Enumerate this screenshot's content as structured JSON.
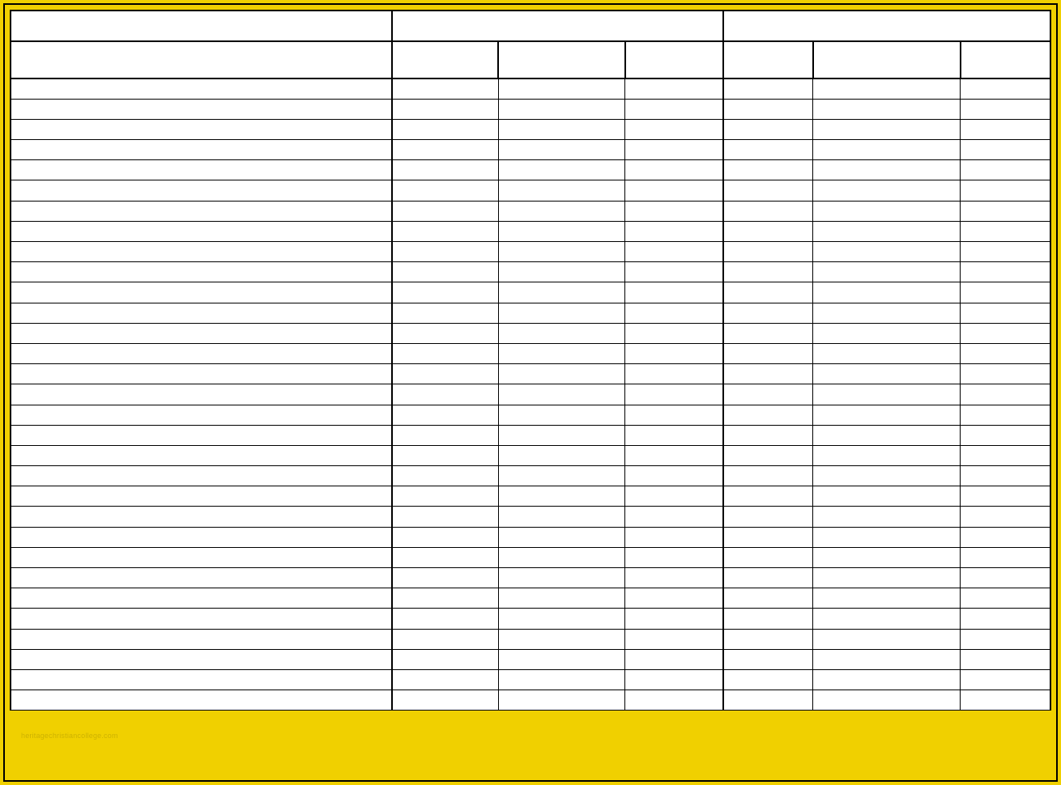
{
  "sheet": {
    "top_headers": {
      "left": "",
      "group1": "",
      "group2": ""
    },
    "sub_headers": {
      "left": "",
      "b": "",
      "c": "",
      "d": "",
      "e": "",
      "f": "",
      "g": ""
    },
    "rows": [
      {
        "a": "",
        "b": "",
        "c": "",
        "d": "",
        "e": "",
        "f": "",
        "g": ""
      },
      {
        "a": "",
        "b": "",
        "c": "",
        "d": "",
        "e": "",
        "f": "",
        "g": ""
      },
      {
        "a": "",
        "b": "",
        "c": "",
        "d": "",
        "e": "",
        "f": "",
        "g": ""
      },
      {
        "a": "",
        "b": "",
        "c": "",
        "d": "",
        "e": "",
        "f": "",
        "g": ""
      },
      {
        "a": "",
        "b": "",
        "c": "",
        "d": "",
        "e": "",
        "f": "",
        "g": ""
      },
      {
        "a": "",
        "b": "",
        "c": "",
        "d": "",
        "e": "",
        "f": "",
        "g": ""
      },
      {
        "a": "",
        "b": "",
        "c": "",
        "d": "",
        "e": "",
        "f": "",
        "g": ""
      },
      {
        "a": "",
        "b": "",
        "c": "",
        "d": "",
        "e": "",
        "f": "",
        "g": ""
      },
      {
        "a": "",
        "b": "",
        "c": "",
        "d": "",
        "e": "",
        "f": "",
        "g": ""
      },
      {
        "a": "",
        "b": "",
        "c": "",
        "d": "",
        "e": "",
        "f": "",
        "g": ""
      },
      {
        "a": "",
        "b": "",
        "c": "",
        "d": "",
        "e": "",
        "f": "",
        "g": ""
      },
      {
        "a": "",
        "b": "",
        "c": "",
        "d": "",
        "e": "",
        "f": "",
        "g": ""
      },
      {
        "a": "",
        "b": "",
        "c": "",
        "d": "",
        "e": "",
        "f": "",
        "g": ""
      },
      {
        "a": "",
        "b": "",
        "c": "",
        "d": "",
        "e": "",
        "f": "",
        "g": ""
      },
      {
        "a": "",
        "b": "",
        "c": "",
        "d": "",
        "e": "",
        "f": "",
        "g": ""
      },
      {
        "a": "",
        "b": "",
        "c": "",
        "d": "",
        "e": "",
        "f": "",
        "g": ""
      },
      {
        "a": "",
        "b": "",
        "c": "",
        "d": "",
        "e": "",
        "f": "",
        "g": ""
      },
      {
        "a": "",
        "b": "",
        "c": "",
        "d": "",
        "e": "",
        "f": "",
        "g": ""
      },
      {
        "a": "",
        "b": "",
        "c": "",
        "d": "",
        "e": "",
        "f": "",
        "g": ""
      },
      {
        "a": "",
        "b": "",
        "c": "",
        "d": "",
        "e": "",
        "f": "",
        "g": ""
      },
      {
        "a": "",
        "b": "",
        "c": "",
        "d": "",
        "e": "",
        "f": "",
        "g": ""
      },
      {
        "a": "",
        "b": "",
        "c": "",
        "d": "",
        "e": "",
        "f": "",
        "g": ""
      },
      {
        "a": "",
        "b": "",
        "c": "",
        "d": "",
        "e": "",
        "f": "",
        "g": ""
      },
      {
        "a": "",
        "b": "",
        "c": "",
        "d": "",
        "e": "",
        "f": "",
        "g": ""
      },
      {
        "a": "",
        "b": "",
        "c": "",
        "d": "",
        "e": "",
        "f": "",
        "g": ""
      },
      {
        "a": "",
        "b": "",
        "c": "",
        "d": "",
        "e": "",
        "f": "",
        "g": ""
      },
      {
        "a": "",
        "b": "",
        "c": "",
        "d": "",
        "e": "",
        "f": "",
        "g": ""
      },
      {
        "a": "",
        "b": "",
        "c": "",
        "d": "",
        "e": "",
        "f": "",
        "g": ""
      },
      {
        "a": "",
        "b": "",
        "c": "",
        "d": "",
        "e": "",
        "f": "",
        "g": ""
      },
      {
        "a": "",
        "b": "",
        "c": "",
        "d": "",
        "e": "",
        "f": "",
        "g": ""
      },
      {
        "a": "",
        "b": "",
        "c": "",
        "d": "",
        "e": "",
        "f": "",
        "g": ""
      }
    ],
    "watermark": "heritagechristiancollege.com"
  }
}
